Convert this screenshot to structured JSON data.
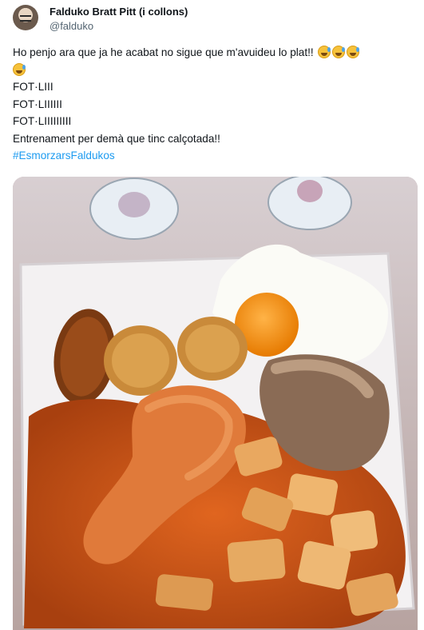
{
  "author": {
    "display_name": "Falduko Bratt Pitt (i collons)",
    "handle": "@falduko"
  },
  "tweet": {
    "line1": "Ho penjo ara que ja he acabat no sigue que m'avuideu lo plat!!",
    "line2": "FOT·LIII",
    "line3": "FOT·LIIIIII",
    "line4": "FOT·LIIIIIIIII",
    "line5": "Entrenament per demà que tinc calçotada!!",
    "hashtag": "#EsmorzarsFaldukos",
    "emoji": "grinning-face-with-sweat"
  },
  "media": {
    "subject": "plate-of-food-photo"
  }
}
